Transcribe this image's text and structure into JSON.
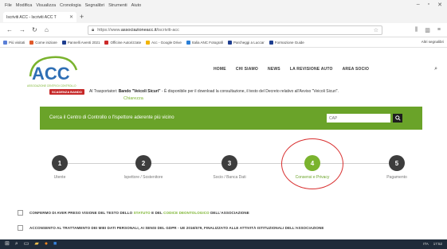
{
  "browser": {
    "menu": [
      "File",
      "Modifica",
      "Visualizza",
      "Cronologia",
      "Segnalibri",
      "Strumenti",
      "Aiuto"
    ],
    "tab_title": "Iscriviti ACC - Iscriviti ACC T",
    "url_prefix": "https://www.",
    "url_domain": "associazioneacc.it",
    "url_path": "/iscriviti-acc",
    "bookmarks": [
      "Più visitati",
      "Come iniziare",
      "Pannelli Aventi 2021",
      "Officine Autorizzate",
      "Acc - Google Drive",
      "Italia ANC Fotografi",
      "Parcheggi a Luccar",
      "Formazione Guide"
    ],
    "bookmarks_other": "Altri segnalibri"
  },
  "site": {
    "logo_text": "ACC",
    "logo_tagline": "ASSOCIAZIONE CENTRI DI CONTROLLO",
    "nav": [
      "HOME",
      "CHI SIAMO",
      "NEWS",
      "LA REVISIONE AUTO",
      "AREA SOCIO"
    ]
  },
  "notice": {
    "badge": "SCADENZA BANDO",
    "text_before": "Al Trasportatori: ",
    "highlight": "Bando \"Veicoli Sicuri\"",
    "text_after": " - È disponibile per il download la consultazione, il testo del Decreto relativo all'Avviso \"Veicoli Sicuri\".",
    "link": "Chiarezza"
  },
  "search_band": {
    "text": "Cerca il Centro di Controllo o l'Ispettore aderente più vicino",
    "placeholder": "CAP"
  },
  "steps": [
    {
      "num": "1",
      "label": "Utente"
    },
    {
      "num": "2",
      "label": "Ispettore / Sostenitore"
    },
    {
      "num": "3",
      "label": "Socio / Banca Dati"
    },
    {
      "num": "4",
      "label": "Consensi e Privacy"
    },
    {
      "num": "5",
      "label": "Pagamento"
    }
  ],
  "consents": [
    {
      "pre": "CONFERMO DI AVER PRESO VISIONE DEL TESTO DELLO ",
      "link1": "STATUTO",
      "mid": " E DEL ",
      "link2": "CODICE DEONTOLOGICO",
      "post": " DELL'ASSOCIAZIONE"
    },
    {
      "pre": "ACCONSENTO AL TRATTAMENTO DEI MIEI DATI PERSONALI, AI SENSI DEL GDPR - UE 2016/679, FINALIZZATO ALLE ATTIVITÀ ISTITUZIONALI DELL'ASSOCIAZIONE",
      "link1": "",
      "mid": "",
      "link2": "",
      "post": ""
    }
  ],
  "taskbar": {
    "language": "ITA",
    "time": "17:52"
  },
  "colors": {
    "green": "#6aa329",
    "active_step": "#7ab32e",
    "dark_step": "#3d3d3d",
    "annotation": "#d93030"
  }
}
